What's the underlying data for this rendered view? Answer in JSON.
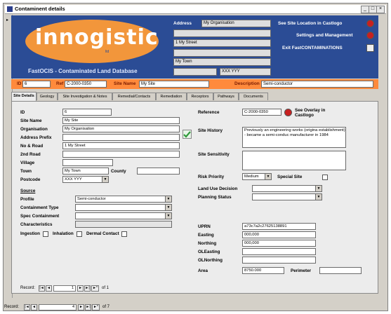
{
  "window": {
    "title": "Contaminent details",
    "min": "_",
    "max": "□",
    "close": "×"
  },
  "logo": {
    "brand": "innogistic",
    "sub": "ltd",
    "tagline": "FastOCIS - Contaminated Land Database"
  },
  "address": {
    "label": "Address",
    "line1": "My Organisation",
    "line2": "",
    "line3": "1 My Street",
    "line4": "",
    "line5": "My Town",
    "postcode_a": "",
    "postcode_b": "XXX YYY"
  },
  "header_links": {
    "see_site": "See Site Location in Castlogo",
    "settings": "Settings and Management",
    "exit": "Exit FastCONTAMINATIONS"
  },
  "refbar": {
    "id_label": "ID",
    "id_value": "6",
    "ref_label": "Ref",
    "ref_value": "C-2000-0350",
    "site_name_label": "Site Name",
    "site_name_value": "My Site",
    "desc_label": "Description",
    "desc_value": "Semi-conductor"
  },
  "tabs": [
    "Site Details",
    "Geology",
    "Site Investigation & Notes",
    "Remedial/Contacts",
    "Remediation",
    "Receptors",
    "Pathways",
    "Documents"
  ],
  "form": {
    "id_label": "ID",
    "id_value": "6",
    "site_name_label": "Site Name",
    "site_name_value": "My Site",
    "organisation_label": "Organisation",
    "organisation_value": "My Organisation",
    "address_prefix_label": "Address Prefix",
    "address_prefix_value": "",
    "no_road_label": "No & Road",
    "no_road_value": "1 My Street",
    "second_road_label": "2nd Road",
    "second_road_value": "",
    "village_label": "Village",
    "village_value": "",
    "town_label": "Town",
    "town_value": "My Town",
    "county_label": "County",
    "county_value": "",
    "postcode_label": "Postcode",
    "postcode_value": "XXX YYY",
    "source_label": "Source",
    "profile_label": "Profile",
    "profile_value": "Semi-conductor",
    "cont_type_label": "Containment Type",
    "cont_type_value": "",
    "spec_cont_label": "Spec Containment",
    "spec_cont_value": "",
    "characteristics_label": "Characteristics",
    "characteristics_value": "",
    "ingestion_label": "Ingestion",
    "inhalation_label": "Inhalation",
    "dermal_label": "Dermal Contact",
    "reference_label": "Reference",
    "reference_value": "C-2000-0350",
    "see_overlay": "See Overlay in Castlogo",
    "site_history_label": "Site History",
    "site_history_value": "Previously an engineering works (origina establishment) - became a semi-conduc manufacturer in 1984",
    "site_sensitivity_label": "Site Sensitivity",
    "site_sensitivity_value": "",
    "risk_priority_label": "Risk Priority",
    "risk_priority_value": "Medium",
    "special_site_label": "Special Site",
    "land_use_label": "Land Use Decision",
    "land_use_value": "",
    "planning_label": "Planning Status",
    "planning_value": "",
    "uprn_label": "UPRN",
    "uprn_value": "a73c7a2c27625138891",
    "easting_label": "Easting",
    "easting_value": "000,000",
    "northing_label": "Northing",
    "northing_value": "000,000",
    "oleasting_label": "OLEasting",
    "oleasting_value": "",
    "olnorthing_label": "OLNorthing",
    "olnorthing_value": "",
    "area_label": "Area",
    "area_value": "8750.000",
    "perimeter_label": "Perimeter",
    "perimeter_value": ""
  },
  "inner_nav": {
    "label": "Record:",
    "first": "|◄",
    "prev": "◄",
    "current": "1",
    "next": "►",
    "last": "►|",
    "new": "►*",
    "of": "of 1"
  },
  "outer_nav": {
    "label": "Record:",
    "first": "|◄",
    "prev": "◄",
    "current": "4",
    "next": "►",
    "last": "►|",
    "new": "►*",
    "of": "of 7"
  },
  "colors": {
    "header_blue": "#2b4c95",
    "orange": "#f2963b",
    "refbar": "#ff8a3c",
    "check_green": "#2f9a3a"
  }
}
